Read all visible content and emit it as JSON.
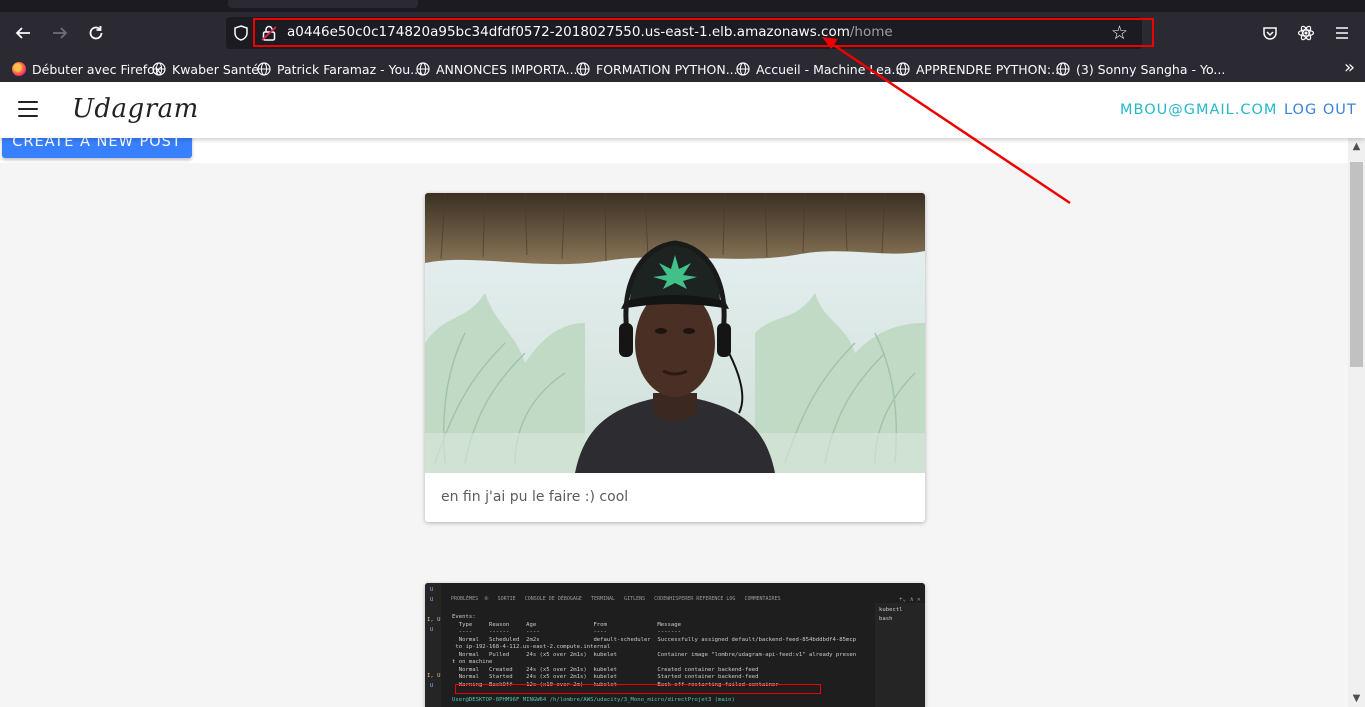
{
  "browser": {
    "url_host": "a0446e50c0c174820a95bc34dfdf0572-2018027550.us-east-1.elb.amazonaws.com",
    "url_path": "/home",
    "bookmarks": [
      {
        "label": "Débuter avec Firefox",
        "icon": "firefox-icon"
      },
      {
        "label": "Kwaber Santé",
        "icon": "globe-icon"
      },
      {
        "label": "Patrick Faramaz - You...",
        "icon": "globe-icon"
      },
      {
        "label": "ANNONCES IMPORTA...",
        "icon": "globe-icon"
      },
      {
        "label": "FORMATION PYTHON...",
        "icon": "globe-icon"
      },
      {
        "label": "Accueil - Machine Lea...",
        "icon": "globe-icon"
      },
      {
        "label": "APPRENDRE PYTHON:...",
        "icon": "globe-icon"
      },
      {
        "label": "(3) Sonny Sangha - Yo...",
        "icon": "globe-icon"
      }
    ],
    "annotation_color": "#ee0000"
  },
  "app": {
    "brand": "Udagram",
    "user_email": "MBOU@GMAIL.COM",
    "logout_label": "LOG OUT",
    "create_post_label": "CREATE A NEW POST",
    "accent": "#3880ff"
  },
  "feed": [
    {
      "caption": "en fin j'ai pu le faire :) cool",
      "image": "photo of a man wearing a cap and headphones"
    },
    {
      "caption": "",
      "image": "terminal screenshot"
    }
  ],
  "terminal": {
    "tabs": "PROBLÈMES  ⑥   SORTIE   CONSOLE DE DÉBOGAGE   TERMINAL   GITLENS   CODEWHISPERER REFERENCE LOG   COMMENTAIRES",
    "lines": [
      "Events:",
      "  Type     Reason     Age                 From               Message",
      "  ----     ------     ----                ----               -------",
      "  Normal   Scheduled  2m2s                default-scheduler  Successfully assigned default/backend-feed-854bddbdf4-85mcp",
      " to ip-192-168-4-112.us-east-2.compute.internal",
      "  Normal   Pulled     24s (x5 over 2m1s)  kubelet            Container image \"lombre/udagram-api-feed:v1\" already presen",
      "t on machine",
      "  Normal   Created    24s (x5 over 2m1s)  kubelet            Created container backend-feed",
      "  Normal   Started    24s (x5 over 2m1s)  kubelet            Started container backend-feed",
      "  Warning  BackOff    12s (x10 over 2m)   kubelet            Back-off restarting failed container",
      "",
      "User@DESKTOP-8PHM96F MINGW64 /h/lombre/AWS/udacity/3_Mono_micro/directProjet3 (main)"
    ],
    "side_items": [
      "kubectl",
      "bash"
    ]
  }
}
